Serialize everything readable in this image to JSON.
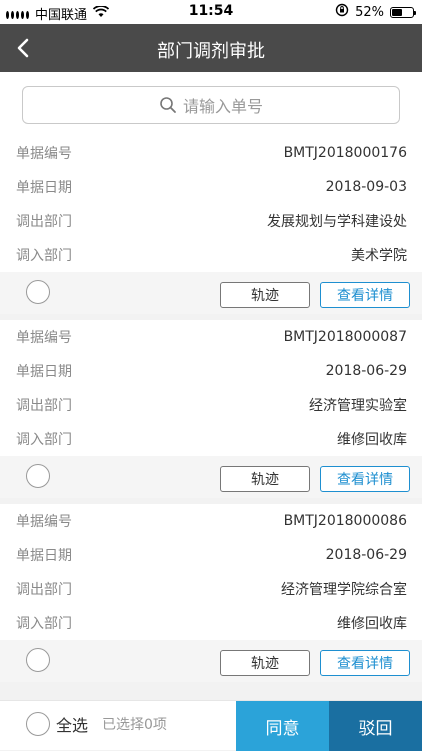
{
  "status_bar": {
    "carrier": "中国联通",
    "time": "11:54",
    "battery": "52%",
    "battery_level": 0.52
  },
  "navbar": {
    "title": "部门调剂审批"
  },
  "search": {
    "placeholder": "请输入单号"
  },
  "labels": {
    "no": "单据编号",
    "date": "单据日期",
    "out": "调出部门",
    "in": "调入部门",
    "track": "轨迹",
    "detail": "查看详情"
  },
  "items": [
    {
      "no": "BMTJ2018000176",
      "date": "2018-09-03",
      "out": "发展规划与学科建设处",
      "in": "美术学院"
    },
    {
      "no": "BMTJ2018000087",
      "date": "2018-06-29",
      "out": "经济管理实验室",
      "in": "维修回收库"
    },
    {
      "no": "BMTJ2018000086",
      "date": "2018-06-29",
      "out": "经济管理学院综合室",
      "in": "维修回收库"
    }
  ],
  "bottom": {
    "select_all": "全选",
    "selected": "已选择0项",
    "approve": "同意",
    "reject": "驳回"
  },
  "colors": {
    "nav_bg": "#4a4a4a",
    "accent": "#1e8fd0",
    "approve": "#2ba3d9",
    "reject": "#1a6fa1"
  }
}
